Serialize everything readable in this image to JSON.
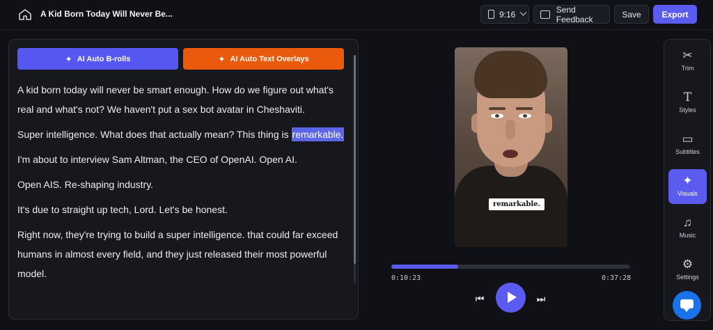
{
  "header": {
    "home_icon": "home-icon",
    "project_title": "A Kid Born Today Will Never Be...",
    "aspect_ratio": "9:16",
    "feedback_label": "Send Feedback",
    "save_label": "Save",
    "export_label": "Export"
  },
  "transcript": {
    "broll_button": "AI Auto B-rolls",
    "overlay_button": "AI Auto Text Overlays",
    "paragraphs": [
      "A kid born today will never be smart enough. How do we figure out what's real and what's not? We haven't put a sex bot avatar in Cheshaviti.",
      "Super intelligence. What does that actually mean? This thing is",
      "I'm about to interview Sam Altman, the CEO of OpenAI. Open AI.",
      "Open AIS. Re-shaping industry.",
      "It's due to straight up tech, Lord. Let's be honest.",
      "Right now, they're trying to build a super intelligence. that could far exceed humans in almost every field, and they just released their most powerful model."
    ],
    "highlighted_word": "remarkable."
  },
  "player": {
    "caption": "remarkable.",
    "current_time": "0:10:23",
    "total_time": "0:37:28",
    "progress_fraction": 0.28
  },
  "sidebar": {
    "items": [
      {
        "label": "Trim",
        "icon": "scissors-icon"
      },
      {
        "label": "Styles",
        "icon": "text-icon"
      },
      {
        "label": "Subtitles",
        "icon": "subtitles-icon"
      },
      {
        "label": "Visuals",
        "icon": "sparkle-icon"
      },
      {
        "label": "Music",
        "icon": "music-icon"
      },
      {
        "label": "Settings",
        "icon": "gear-icon"
      }
    ],
    "active": "Visuals"
  },
  "colors": {
    "accent": "#5b5bf0",
    "overlay_orange": "#ea5a0c",
    "background": "#0f1117"
  }
}
